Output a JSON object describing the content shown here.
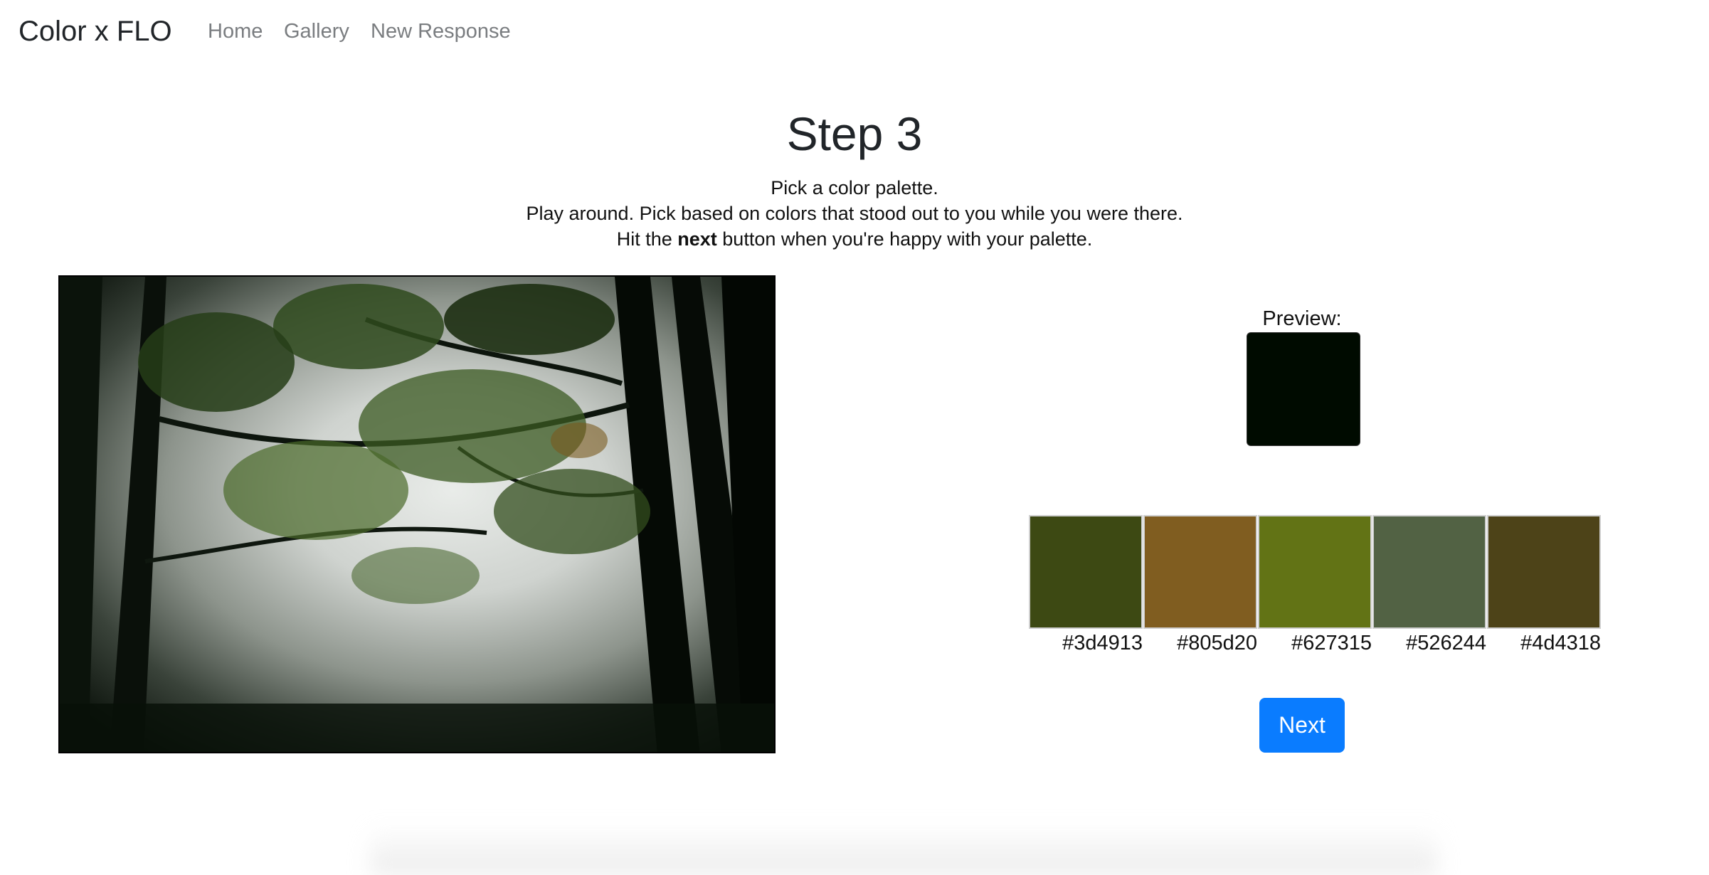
{
  "nav": {
    "brand": "Color x FLO",
    "links": [
      "Home",
      "Gallery",
      "New Response"
    ]
  },
  "step": {
    "title": "Step 3",
    "line1": "Pick a color palette.",
    "line2": "Play around. Pick based on colors that stood out to you while you were there.",
    "line3_before": "Hit the ",
    "line3_bold": "next",
    "line3_after": " button when you're happy with your palette."
  },
  "preview": {
    "label": "Preview:",
    "color": "#000b00"
  },
  "palette": [
    {
      "hex": "#3d4913"
    },
    {
      "hex": "#805d20"
    },
    {
      "hex": "#627315"
    },
    {
      "hex": "#526244"
    },
    {
      "hex": "#4d4318"
    }
  ],
  "buttons": {
    "next": "Next"
  },
  "colors": {
    "accent": "#0a7cff",
    "nav_link": "#7a7d80"
  }
}
